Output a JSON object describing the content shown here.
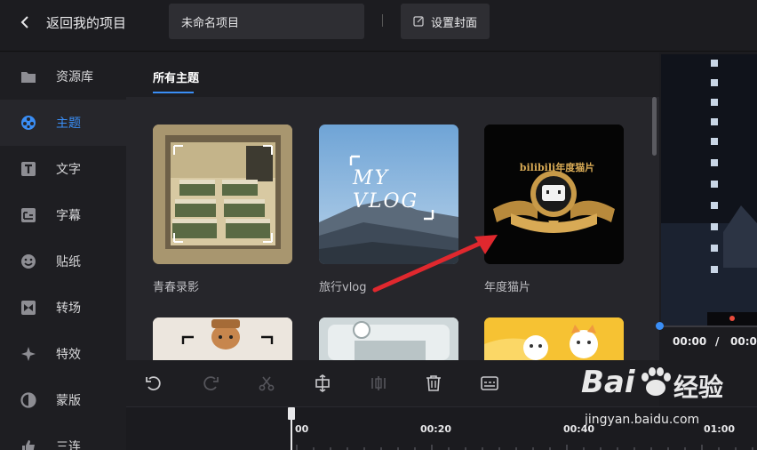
{
  "header": {
    "back_label": "返回我的项目",
    "project_name": "未命名项目",
    "cover_button": "设置封面"
  },
  "sidebar": {
    "items": [
      {
        "label": "资源库",
        "icon": "folder-icon",
        "active": false
      },
      {
        "label": "主题",
        "icon": "theme-reel-icon",
        "active": true
      },
      {
        "label": "文字",
        "icon": "text-icon",
        "active": false
      },
      {
        "label": "字幕",
        "icon": "subtitle-icon",
        "active": false
      },
      {
        "label": "贴纸",
        "icon": "sticker-icon",
        "active": false
      },
      {
        "label": "转场",
        "icon": "transition-icon",
        "active": false
      },
      {
        "label": "特效",
        "icon": "effects-icon",
        "active": false
      },
      {
        "label": "蒙版",
        "icon": "mask-icon",
        "active": false
      },
      {
        "label": "三连",
        "icon": "thumbs-up-icon",
        "active": false
      }
    ]
  },
  "main": {
    "tab": "所有主题",
    "themes": [
      {
        "label": "青春录影"
      },
      {
        "label": "旅行vlog",
        "thumb_text": "MY VLOG"
      },
      {
        "label": "年度猫片",
        "thumb_text": "bilibili年度猫片"
      },
      {
        "label": ""
      },
      {
        "label": ""
      },
      {
        "label": ""
      }
    ]
  },
  "preview": {
    "time_current": "00:00",
    "time_separator": "/",
    "time_total": "00:0"
  },
  "toolbar": {
    "tools": [
      "undo-icon",
      "redo-icon",
      "cut-icon",
      "crop-icon",
      "split-icon",
      "delete-icon",
      "subtitle-edit-icon"
    ]
  },
  "timeline": {
    "ticks": [
      "00",
      "00:20",
      "00:40",
      "01:00"
    ]
  },
  "watermark": {
    "brand": "Bai",
    "brand_suffix": "经验",
    "url": "jingyan.baidu.com"
  },
  "colors": {
    "accent": "#3a8ef6",
    "annotation_arrow": "#e0282e"
  }
}
